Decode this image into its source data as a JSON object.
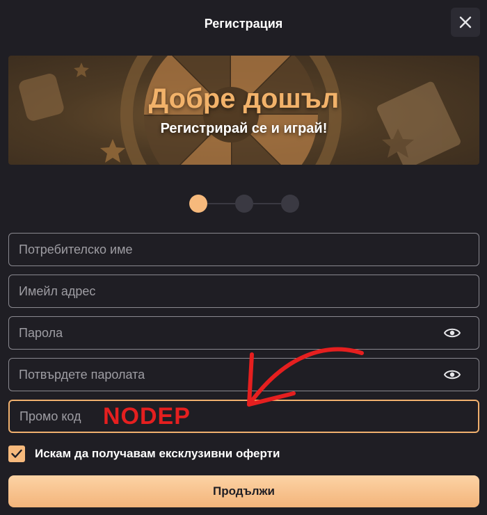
{
  "header": {
    "title": "Регистрация"
  },
  "banner": {
    "title": "Добре дошъл",
    "subtitle": "Регистрирай се и играй!"
  },
  "stepper": {
    "current": 1,
    "total": 3
  },
  "form": {
    "username_placeholder": "Потребителско име",
    "email_placeholder": "Имейл адрес",
    "password_placeholder": "Парола",
    "confirm_password_placeholder": "Потвърдете паролата",
    "promo_placeholder": "Промо код",
    "promo_overlay_text": "NODEP"
  },
  "offers_checkbox": {
    "label": "Искам да получавам ексклузивни оферти",
    "checked": true
  },
  "continue_button": {
    "label": "Продължи"
  },
  "colors": {
    "background": "#1f1e24",
    "accent": "#f6b97c",
    "annotation_red": "#e51f1f"
  },
  "icons": [
    "close-icon",
    "eye-icon",
    "check-icon",
    "arrow-annotation"
  ]
}
